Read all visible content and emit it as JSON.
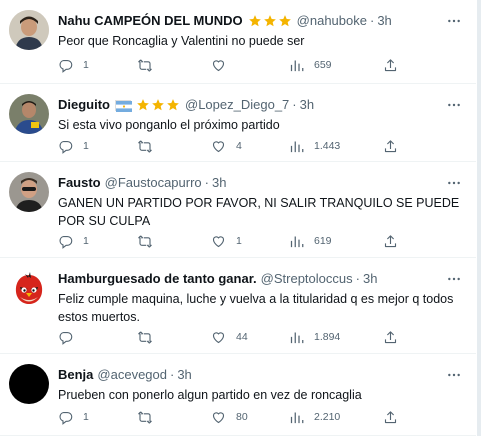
{
  "tweets": [
    {
      "name": "Nahu CAMPEÓN DEL MUNDO",
      "badge": "stars",
      "handle": "@nahuboke",
      "separator": "·",
      "time": "3h",
      "text": "Peor que Roncaglia y Valentini no puede ser",
      "replies": "1",
      "retweets": "",
      "likes": "",
      "views": "659"
    },
    {
      "name": "Dieguito",
      "badge": "flag-stars",
      "handle": "@Lopez_Diego_7",
      "separator": "·",
      "time": "3h",
      "text": "Si esta vivo ponganlo el próximo partido",
      "replies": "1",
      "retweets": "",
      "likes": "4",
      "views": "1.443"
    },
    {
      "name": "Fausto",
      "badge": "",
      "handle": "@Faustocapurro",
      "separator": "·",
      "time": "3h",
      "text": "GANEN UN PARTIDO POR FAVOR, NI SALIR TRANQUILO SE PUEDE POR SU CULPA",
      "replies": "1",
      "retweets": "",
      "likes": "1",
      "views": "619"
    },
    {
      "name": "Hamburguesado de tanto ganar.",
      "badge": "",
      "handle": "@Streptoloccus",
      "separator": "·",
      "time": "3h",
      "text": "Feliz cumple maquina, luche y vuelva a la titularidad q es mejor q todos estos muertos.",
      "replies": "",
      "retweets": "",
      "likes": "44",
      "views": "1.894"
    },
    {
      "name": "Benja",
      "badge": "",
      "handle": "@acevegod",
      "separator": "·",
      "time": "3h",
      "text": "Prueben con ponerlo algun partido en vez de roncaglia",
      "replies": "1",
      "retweets": "",
      "likes": "80",
      "views": "2.210"
    }
  ],
  "colors": {
    "text": "#0f1419",
    "muted": "#536471",
    "star": "#f4b400",
    "divider": "#eff3f4"
  }
}
